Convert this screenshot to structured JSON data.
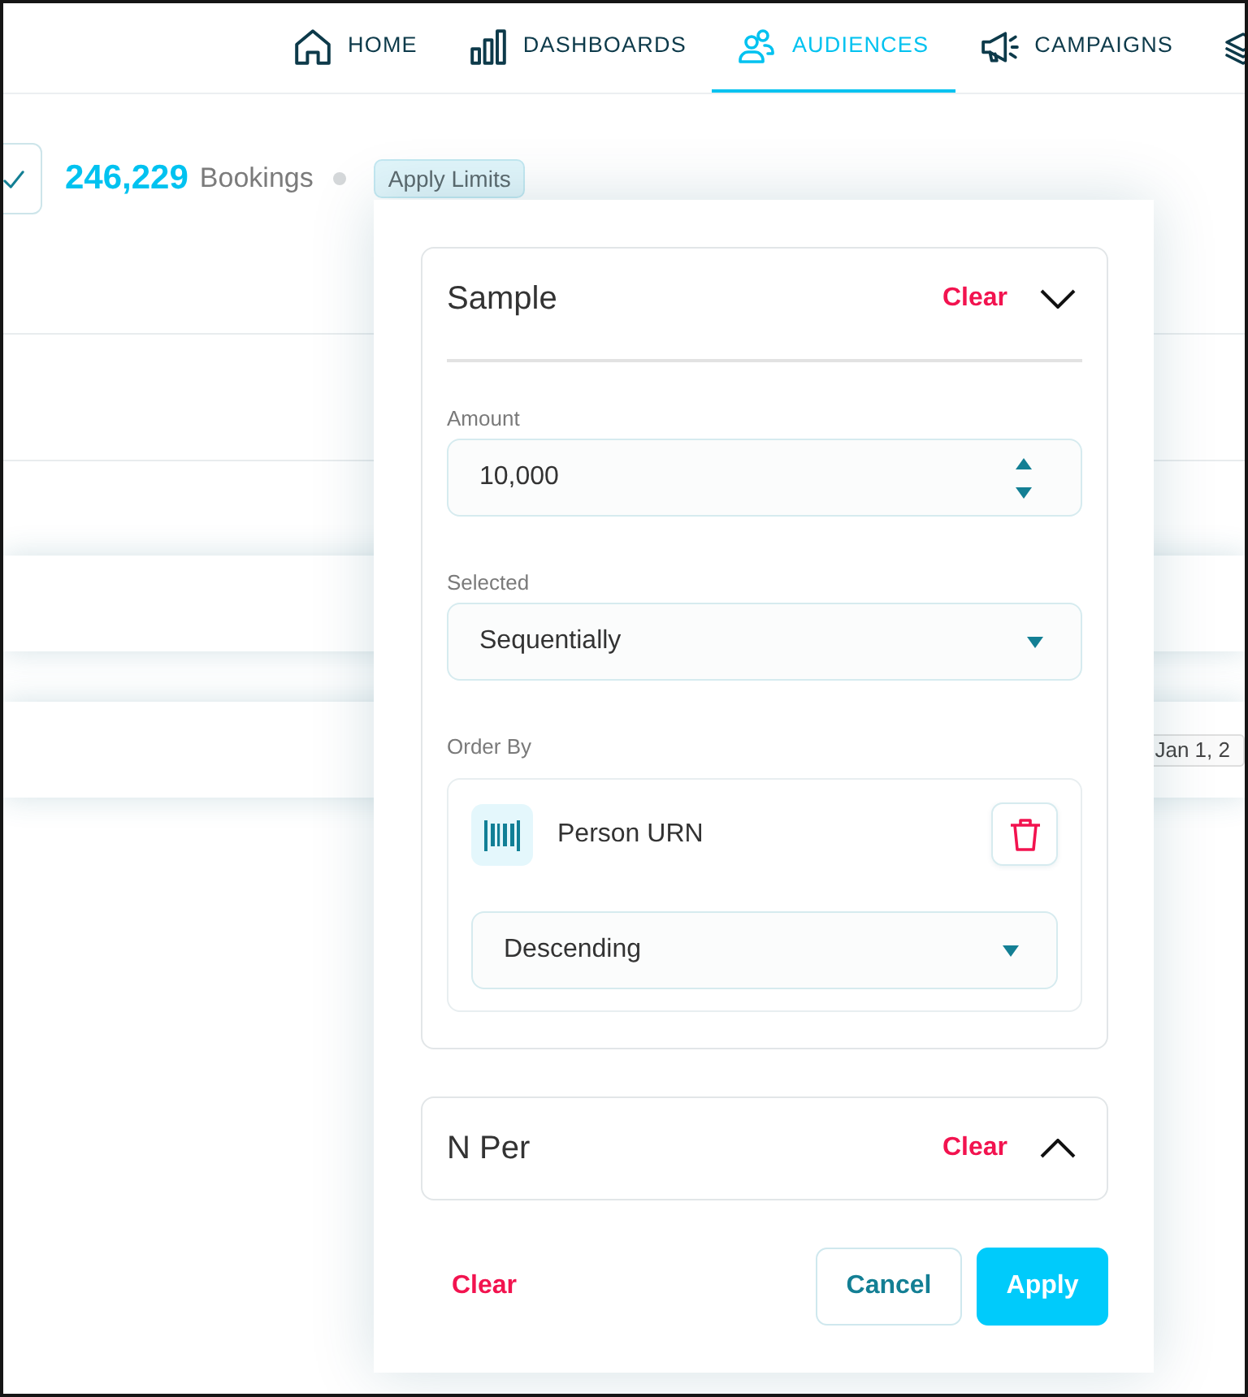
{
  "nav": {
    "items": [
      {
        "label": "HOME",
        "selected": false
      },
      {
        "label": "DASHBOARDS",
        "selected": false
      },
      {
        "label": "AUDIENCES",
        "selected": true
      },
      {
        "label": "CAMPAIGNS",
        "selected": false
      }
    ]
  },
  "summary": {
    "count": "246,229",
    "unit": "Bookings",
    "badge": "Apply Limits"
  },
  "table": {
    "date_chip": "Jan 1, 2"
  },
  "filter_panel": {
    "sections": [
      {
        "title": "Sample",
        "clear": "Clear",
        "expanded": true,
        "fields": [
          {
            "kind": "number",
            "label": "Amount",
            "value": "10,000"
          },
          {
            "kind": "select",
            "label": "Selected",
            "value": "Sequentially"
          },
          {
            "kind": "order",
            "label": "Order By",
            "items": [
              {
                "field": "Person URN",
                "direction": "Descending"
              }
            ]
          }
        ]
      },
      {
        "title": "N Per",
        "clear": "Clear",
        "expanded": false
      }
    ],
    "footer": {
      "clear": "Clear",
      "buttons": [
        {
          "label": "Cancel",
          "kind": "secondary"
        },
        {
          "label": "Apply",
          "kind": "primary"
        }
      ]
    }
  }
}
